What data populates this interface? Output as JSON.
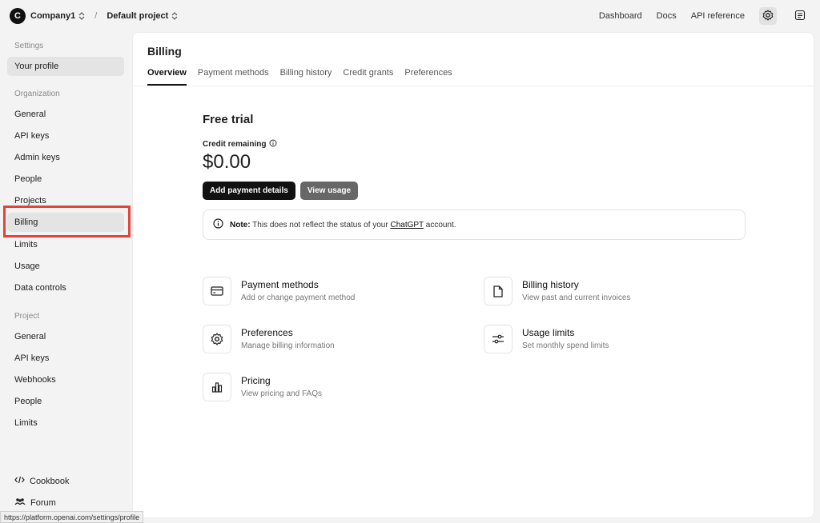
{
  "topbar": {
    "org_initial": "C",
    "org_name": "Company1",
    "project_name": "Default project",
    "links": [
      "Dashboard",
      "Docs",
      "API reference"
    ]
  },
  "sidebar": {
    "settings_heading": "Settings",
    "your_profile": "Your profile",
    "organization_heading": "Organization",
    "org_items": [
      "General",
      "API keys",
      "Admin keys",
      "People",
      "Projects",
      "Billing",
      "Limits",
      "Usage",
      "Data controls"
    ],
    "project_heading": "Project",
    "project_items": [
      "General",
      "API keys",
      "Webhooks",
      "People",
      "Limits"
    ],
    "footer": {
      "cookbook": "Cookbook",
      "forum": "Forum"
    }
  },
  "main": {
    "title": "Billing",
    "tabs": [
      "Overview",
      "Payment methods",
      "Billing history",
      "Credit grants",
      "Preferences"
    ],
    "active_tab": "Overview",
    "plan": "Free trial",
    "credit_label": "Credit remaining",
    "credit_amount": "$0.00",
    "add_payment_label": "Add payment details",
    "view_usage_label": "View usage",
    "note_prefix": "Note:",
    "note_text_before": "This does not reflect the status of your",
    "note_link": "ChatGPT",
    "note_text_after": "account.",
    "cards": [
      {
        "title": "Payment methods",
        "sub": "Add or change payment method"
      },
      {
        "title": "Billing history",
        "sub": "View past and current invoices"
      },
      {
        "title": "Preferences",
        "sub": "Manage billing information"
      },
      {
        "title": "Usage limits",
        "sub": "Set monthly spend limits"
      },
      {
        "title": "Pricing",
        "sub": "View pricing and FAQs"
      }
    ]
  },
  "status_url": "https://platform.openai.com/settings/profile",
  "colors": {
    "highlight": "#e0443a",
    "primary_button": "#111111",
    "secondary_button": "#676767"
  }
}
